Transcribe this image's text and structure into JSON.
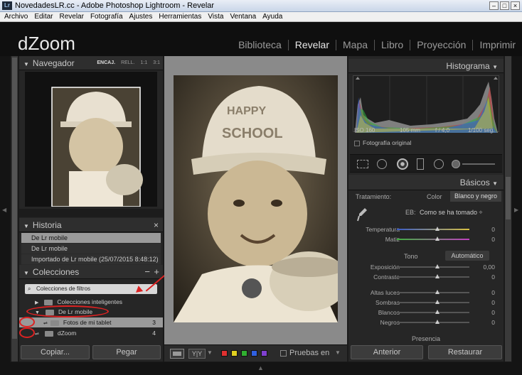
{
  "window": {
    "title": "NovedadesLR.cc - Adobe Photoshop Lightroom - Revelar",
    "app_badge": "Lr"
  },
  "menu": [
    "Archivo",
    "Editar",
    "Revelar",
    "Fotografía",
    "Ajustes",
    "Herramientas",
    "Vista",
    "Ventana",
    "Ayuda"
  ],
  "identity": {
    "logo": "dZoom"
  },
  "modules": [
    "Biblioteca",
    "Revelar",
    "Mapa",
    "Libro",
    "Proyección",
    "Imprimir"
  ],
  "modules_active": "Revelar",
  "navigator": {
    "title": "Navegador",
    "zoom": [
      "ENCAJ.",
      "RELL.",
      "1:1",
      "3:1"
    ]
  },
  "history": {
    "title": "Historia",
    "close": "×",
    "items": [
      "De Lr mobile",
      "De Lr mobile",
      "Importado de Lr mobile (25/07/2015 8:48:12)"
    ]
  },
  "collections": {
    "title": "Colecciones",
    "add": "+",
    "minus": "−",
    "search": "Colecciones de filtros",
    "items": [
      {
        "label": "Colecciones inteligentes",
        "count": ""
      },
      {
        "label": "De Lr mobile",
        "count": ""
      },
      {
        "label": "Fotos de mi tablet",
        "count": "3"
      },
      {
        "label": "dZoom",
        "count": "4"
      }
    ]
  },
  "left_buttons": {
    "copy": "Copiar...",
    "paste": "Pegar"
  },
  "toolbar": {
    "yy": "Y|Y",
    "pruebas": "Pruebas en",
    "swatches": [
      "#e03030",
      "#e0d020",
      "#30b030",
      "#3060e0",
      "#8040d0"
    ]
  },
  "histogram": {
    "title": "Histograma",
    "iso": "ISO 160",
    "focal": "105 mm",
    "aperture": "f / 4,0",
    "shutter": "1/100 seg.",
    "original": "Fotografía original"
  },
  "basic": {
    "title": "Básicos",
    "treatment_label": "Tratamiento:",
    "treatment_color": "Color",
    "treatment_bw": "Blanco y negro",
    "wb_label": "EB:",
    "wb_value": "Como se ha tomado ÷",
    "temp": {
      "label": "Temperatura",
      "value": "0"
    },
    "tint": {
      "label": "Matiz",
      "value": "0"
    },
    "tone_label": "Tono",
    "auto": "Automático",
    "exposure": {
      "label": "Exposición",
      "value": "0,00"
    },
    "contrast": {
      "label": "Contraste",
      "value": "0"
    },
    "highlights": {
      "label": "Altas luces",
      "value": "0"
    },
    "shadows": {
      "label": "Sombras",
      "value": "0"
    },
    "whites": {
      "label": "Blancos",
      "value": "0"
    },
    "blacks": {
      "label": "Negros",
      "value": "0"
    },
    "presence": "Presencia"
  },
  "right_buttons": {
    "prev": "Anterior",
    "reset": "Restaurar"
  }
}
